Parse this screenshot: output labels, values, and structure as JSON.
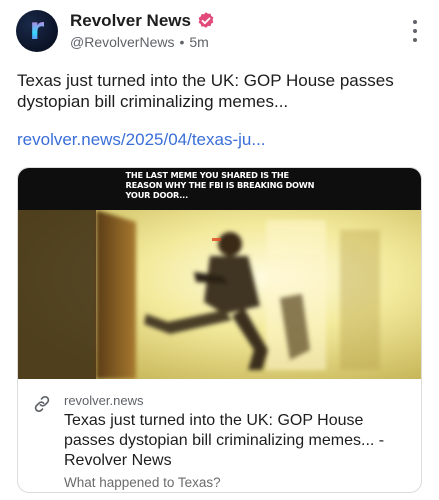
{
  "post": {
    "author": {
      "display_name": "Revolver News",
      "handle": "@RevolverNews",
      "separator": "•",
      "time": "5m",
      "avatar_letter": "r",
      "verified_icon": "verified-badge-icon",
      "verified_color": "#e24a7a"
    },
    "menu_icon": "more-vertical-icon",
    "text": "Texas just turned into the UK: GOP House passes dystopian bill criminalizing memes...",
    "link_text": "revolver.news/2025/04/texas-ju...",
    "link_color": "#3b6fd8",
    "card": {
      "image_caption": "THE LAST MEME YOU SHARED IS THE REASON WHY THE FBI IS BREAKING DOWN YOUR DOOR...",
      "link_icon": "link-icon",
      "domain": "revolver.news",
      "title": "Texas just turned into the UK: GOP House passes dystopian bill criminalizing memes... - Revolver News",
      "description": "What happened to Texas?"
    }
  }
}
